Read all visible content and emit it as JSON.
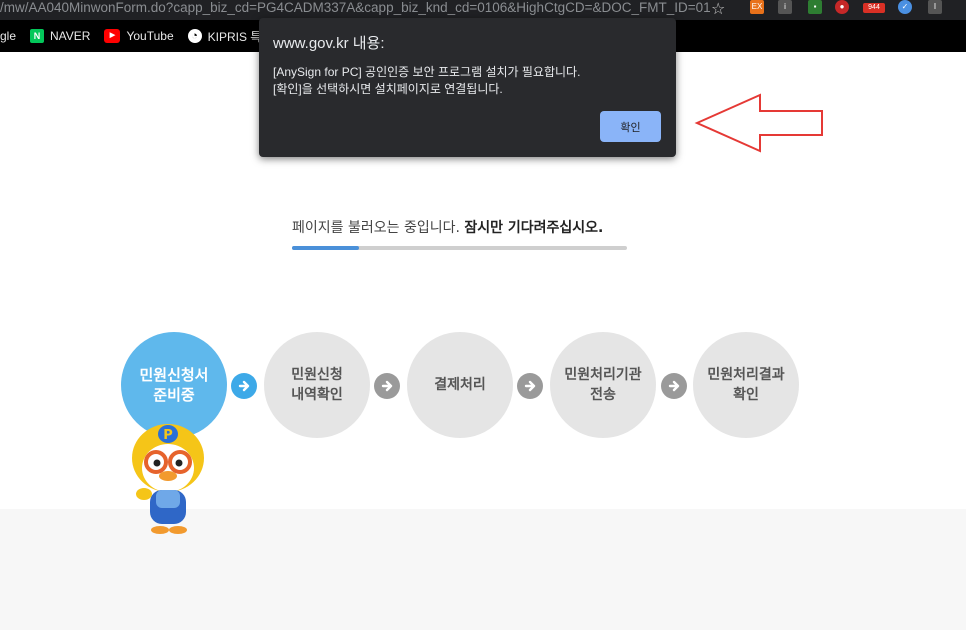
{
  "browser": {
    "url": "/mw/AA040MinwonForm.do?capp_biz_cd=PG4CADM337A&capp_biz_knd_cd=0106&HighCtgCD=&DOC_FMT_ID=01...",
    "extensions": [
      {
        "icon": "ex-extension-icon",
        "label": "EX",
        "color": "#e8711a"
      },
      {
        "icon": "info-extension-icon",
        "label": "i",
        "color": "#555555"
      },
      {
        "icon": "card-extension-icon",
        "label": "▪",
        "color": "#2e7d32"
      },
      {
        "icon": "adblock-extension-icon",
        "label": "●",
        "color": "#c62828"
      },
      {
        "icon": "mail-extension-icon",
        "label": "944",
        "color": "#d93025"
      },
      {
        "icon": "check-extension-icon",
        "label": "✓",
        "color": "#4a90e2"
      },
      {
        "icon": "menu-extension-icon",
        "label": "I",
        "color": "#555555"
      }
    ],
    "bookmarks": [
      {
        "label": "gle",
        "icon": ""
      },
      {
        "label": "NAVER",
        "icon": "N",
        "color": "#03c75a"
      },
      {
        "label": "YouTube",
        "icon": "▶",
        "color": "#ff0000"
      },
      {
        "label": "KIPRIS 특",
        "icon": "◔",
        "color": "#000000"
      }
    ]
  },
  "dialog": {
    "title": "www.gov.kr 내용:",
    "message_line1": "[AnySign for PC] 공인인증 보안 프로그램 설치가 필요합니다.",
    "message_line2": "[확인]을 선택하시면 설치페이지로 연결됩니다.",
    "ok_label": "확인"
  },
  "loading": {
    "text": "페이지를 불러오는 중입니다.",
    "emphasis": "잠시만 기다려주십시오.",
    "progress": 0.2
  },
  "steps": [
    {
      "line1": "민원신청서",
      "line2": "준비중",
      "active": true
    },
    {
      "line1": "민원신청",
      "line2": "내역확인",
      "active": false
    },
    {
      "line1": "결제처리",
      "line2": "",
      "active": false
    },
    {
      "line1": "민원처리기관",
      "line2": "전송",
      "active": false
    },
    {
      "line1": "민원처리결과",
      "line2": "확인",
      "active": false
    }
  ],
  "colors": {
    "accent": "#5fb8ec",
    "dialog_button": "#8ab4f8",
    "annotation_arrow": "#e53935"
  }
}
